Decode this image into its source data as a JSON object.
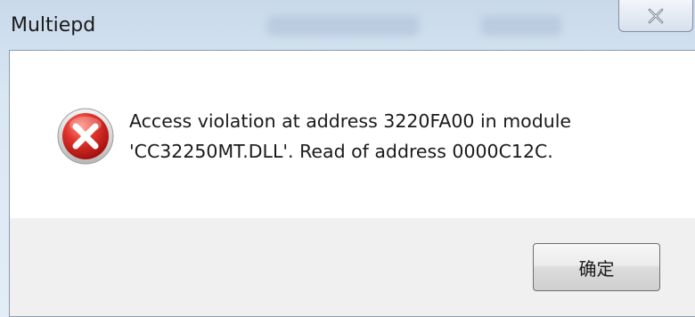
{
  "window": {
    "title": "Multiepd"
  },
  "icons": {
    "close": "close-icon",
    "error": "error-icon"
  },
  "message": {
    "line1": "Access violation at address 3220FA00 in module",
    "line2": "'CC32250MT.DLL'. Read of address 0000C12C."
  },
  "buttons": {
    "ok_label": "确定"
  },
  "colors": {
    "error_red": "#d42020",
    "title_bar": "#d9e6f3",
    "client_bg": "#f0f0f0"
  }
}
